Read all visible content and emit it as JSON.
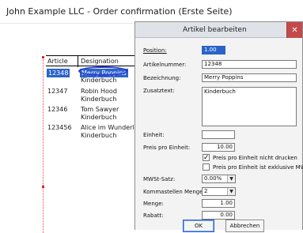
{
  "background_window": {
    "title": "John Example LLC - Order confirmation  (Erste Seite)",
    "table": {
      "headers": [
        "Article",
        "Designation"
      ],
      "rows": [
        {
          "article": "12348",
          "designation": "Merry Poppins",
          "description": "Kinderbuch",
          "selected": true
        },
        {
          "article": "12347",
          "designation": "Robin Hood",
          "description": "Kinderbuch",
          "selected": false
        },
        {
          "article": "12346",
          "designation": "Tom Sawyer",
          "description": "Kinderbuch",
          "selected": false
        },
        {
          "article": "123456",
          "designation": "Alice im Wunderle",
          "description": "Kinderbuch",
          "selected": false
        }
      ]
    }
  },
  "dialog": {
    "title": "Artikel bearbeiten",
    "close_glyph": "✕",
    "labels": {
      "position": "Position:",
      "artikelnummer": "Artikelnummer:",
      "bezeichnung": "Bezeichnung:",
      "zusatztext": "Zusatztext:",
      "einheit": "Einheit:",
      "preis_pro_einheit": "Preis pro Einheit:",
      "mwst_satz": "MWSt-Satz:",
      "kommastellen_menge": "Kommastellen Menge:",
      "menge": "Menge:",
      "rabatt": "Rabatt:"
    },
    "values": {
      "position": "1.00",
      "artikelnummer": "12348",
      "bezeichnung": "Merry Poppins",
      "zusatztext": "Kinderbuch",
      "einheit": "",
      "preis_pro_einheit": "10.00",
      "mwst_satz": "0.00%",
      "kommastellen_menge": "2",
      "menge": "1.00",
      "rabatt": "0.00"
    },
    "checkboxes": [
      {
        "label": "Preis pro Einheit nicht drucken",
        "checked": true
      },
      {
        "label": "Preis pro Einheit ist exklusive MWSt.",
        "checked": false
      }
    ],
    "buttons": {
      "ok": "OK",
      "cancel": "Abbrechen"
    },
    "dropdown_glyph": "▼",
    "check_glyph": "✓"
  }
}
